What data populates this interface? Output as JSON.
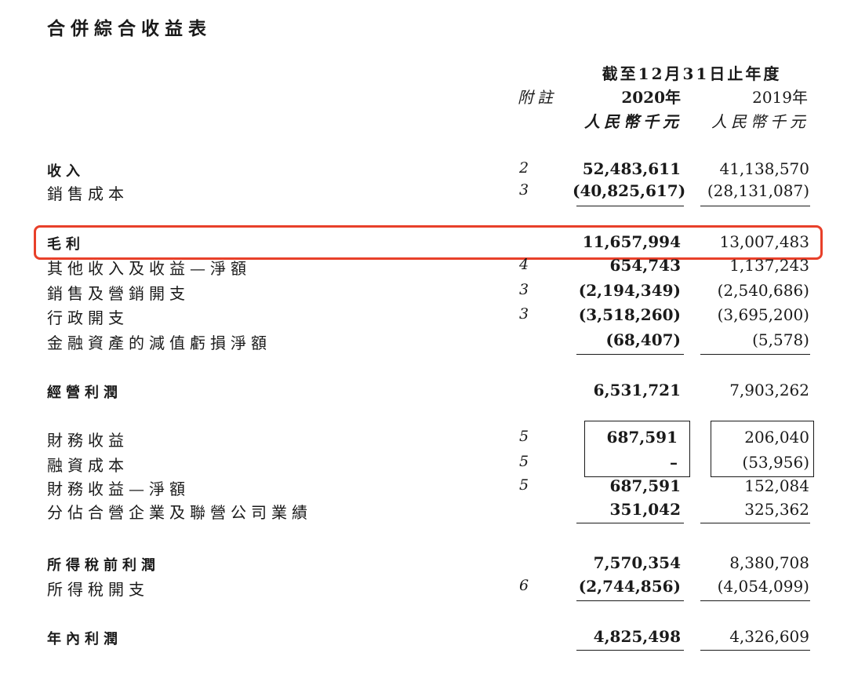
{
  "title": "合併綜合收益表",
  "header": {
    "period": "截至12月31日止年度",
    "note_label": "附註",
    "year_current": "2020年",
    "year_prior": "2019年",
    "unit_current": "人民幣千元",
    "unit_prior": "人民幣千元"
  },
  "rows": [
    {
      "label": "收入",
      "note": "2",
      "current": "52,483,611",
      "prior": "41,138,570"
    },
    {
      "label": "銷售成本",
      "note": "3",
      "current": "(40,825,617)",
      "prior": "(28,131,087)"
    },
    {
      "label": "毛利",
      "note": "",
      "current": "11,657,994",
      "prior": "13,007,483"
    },
    {
      "label": "其他收入及收益—淨額",
      "note": "4",
      "current": "654,743",
      "prior": "1,137,243"
    },
    {
      "label": "銷售及營銷開支",
      "note": "3",
      "current": "(2,194,349)",
      "prior": "(2,540,686)"
    },
    {
      "label": "行政開支",
      "note": "3",
      "current": "(3,518,260)",
      "prior": "(3,695,200)"
    },
    {
      "label": "金融資產的減值虧損淨額",
      "note": "",
      "current": "(68,407)",
      "prior": "(5,578)"
    },
    {
      "label": "經營利潤",
      "note": "",
      "current": "6,531,721",
      "prior": "7,903,262"
    },
    {
      "label": "財務收益",
      "note": "5",
      "current": "687,591",
      "prior": "206,040"
    },
    {
      "label": "融資成本",
      "note": "5",
      "current": "–",
      "prior": "(53,956)"
    },
    {
      "label": "財務收益—淨額",
      "note": "5",
      "current": "687,591",
      "prior": "152,084"
    },
    {
      "label": "分佔合營企業及聯營公司業績",
      "note": "",
      "current": "351,042",
      "prior": "325,362"
    },
    {
      "label": "所得稅前利潤",
      "note": "",
      "current": "7,570,354",
      "prior": "8,380,708"
    },
    {
      "label": "所得稅開支",
      "note": "6",
      "current": "(2,744,856)",
      "prior": "(4,054,099)"
    },
    {
      "label": "年內利潤",
      "note": "",
      "current": "4,825,498",
      "prior": "4,326,609"
    }
  ],
  "highlight_color": "#e8402a"
}
